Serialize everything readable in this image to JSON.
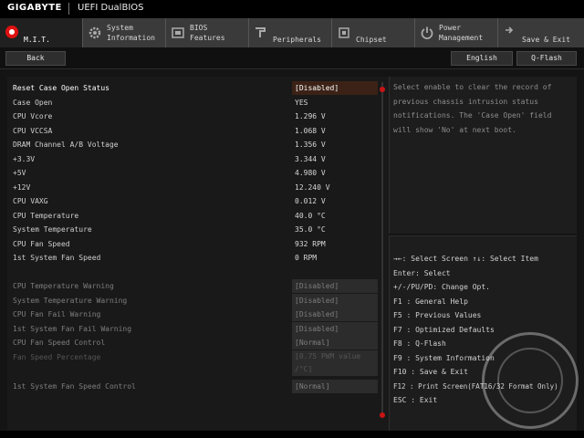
{
  "topbar": {
    "brand": "GIGABYTE",
    "product": "UEFI DualBIOS"
  },
  "tabs": [
    {
      "label": "M.I.T.",
      "icon": "mit-dot-icon",
      "active": true
    },
    {
      "label": "System\nInformation",
      "icon": "gear-icon"
    },
    {
      "label": "BIOS\nFeatures",
      "icon": "bios-features-icon"
    },
    {
      "label": "Peripherals",
      "icon": "peripherals-icon"
    },
    {
      "label": "Chipset",
      "icon": "chipset-icon"
    },
    {
      "label": "Power\nManagement",
      "icon": "power-icon"
    },
    {
      "label": "Save & Exit",
      "icon": "save-exit-icon"
    }
  ],
  "subbar": {
    "back": "Back",
    "language": "English",
    "qflash": "Q-Flash"
  },
  "settings": [
    {
      "label": "Reset Case Open Status",
      "value": "[Disabled]",
      "state": "selected"
    },
    {
      "label": "Case Open",
      "value": "YES"
    },
    {
      "label": "CPU Vcore",
      "value": "   1.296 V"
    },
    {
      "label": "CPU VCCSA",
      "value": "   1.068 V"
    },
    {
      "label": "DRAM Channel A/B Voltage",
      "value": "   1.356 V"
    },
    {
      "label": "+3.3V",
      "value": "   3.344 V"
    },
    {
      "label": "+5V",
      "value": "   4.980 V"
    },
    {
      "label": "+12V",
      "value": "  12.240 V"
    },
    {
      "label": "CPU VAXG",
      "value": "   0.012 V"
    },
    {
      "label": "CPU Temperature",
      "value": "    40.0 °C"
    },
    {
      "label": "System Temperature",
      "value": "    35.0 °C"
    },
    {
      "label": "CPU Fan Speed",
      "value": "     932 RPM"
    },
    {
      "label": "1st System Fan Speed",
      "value": "       0 RPM"
    }
  ],
  "settings2": [
    {
      "label": "CPU Temperature Warning",
      "value": "[Disabled]"
    },
    {
      "label": "System Temperature Warning",
      "value": "[Disabled]"
    },
    {
      "label": "CPU Fan Fail Warning",
      "value": "[Disabled]"
    },
    {
      "label": "1st System Fan Fail Warning",
      "value": "[Disabled]"
    },
    {
      "label": "CPU Fan Speed Control",
      "value": "[Normal]"
    }
  ],
  "fan_percentage": {
    "label": "Fan Speed Percentage",
    "value1": "[0.75 PWM value",
    "value2": "/°C]"
  },
  "sys_fan_control": {
    "label": "1st System Fan Speed Control",
    "value": "[Normal]"
  },
  "help_text": "Select enable to clear the record of previous chassis intrusion status notifications. The 'Case Open' field will show 'No' at next boot.",
  "keys": [
    "→←: Select Screen  ↑↓: Select Item",
    "Enter: Select",
    "+/-/PU/PD: Change Opt.",
    "F1  : General Help",
    "F5  : Previous Values",
    "F7  : Optimized Defaults",
    "F8  : Q-Flash",
    "F9  : System Information",
    "F10 : Save & Exit",
    "F12 : Print Screen(FAT16/32 Format Only)",
    "ESC : Exit"
  ],
  "colors": {
    "accent": "#e01010",
    "selected_bg": "#3c2216",
    "panel": "#191919"
  }
}
